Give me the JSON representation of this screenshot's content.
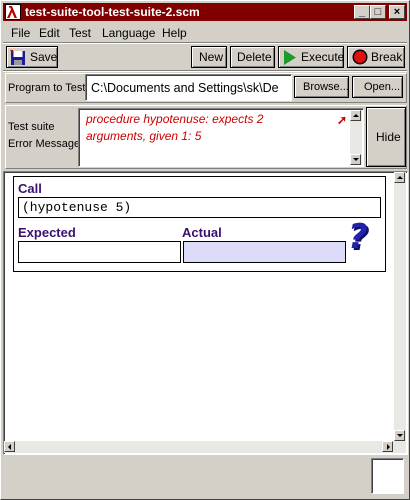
{
  "window": {
    "title": "test-suite-tool-test-suite-2.scm"
  },
  "titlebar_buttons": {
    "minimize": "_",
    "maximize": "□",
    "close": "×"
  },
  "menu": [
    "File",
    "Edit",
    "Test",
    "Language",
    "Help"
  ],
  "toolbar": {
    "save_label": "Save",
    "new_label": "New",
    "delete_label": "Delete",
    "execute_label": "Execute",
    "break_label": "Break"
  },
  "program": {
    "label": "Program to Test",
    "path_value": "C:\\Documents and Settings\\sk\\De",
    "browse_label": "Browse...",
    "open_label": "Open..."
  },
  "error": {
    "label_line1": "Test suite",
    "label_line2": "Error Message",
    "message_line1": "procedure hypotenuse: expects 2",
    "message_line2": "arguments, given 1: 5",
    "hide_label": "Hide"
  },
  "test_case": {
    "call_label": "Call",
    "call_value": "(hypotenuse 5)",
    "expected_label": "Expected",
    "expected_value": "",
    "actual_label": "Actual",
    "actual_value": "",
    "status_glyph": "?"
  },
  "colors": {
    "titlebar": "#800000",
    "error_text": "#cc0000",
    "label_purple": "#3c1070",
    "actual_bg": "#dcdcf8",
    "question_mark": "#2222aa"
  }
}
